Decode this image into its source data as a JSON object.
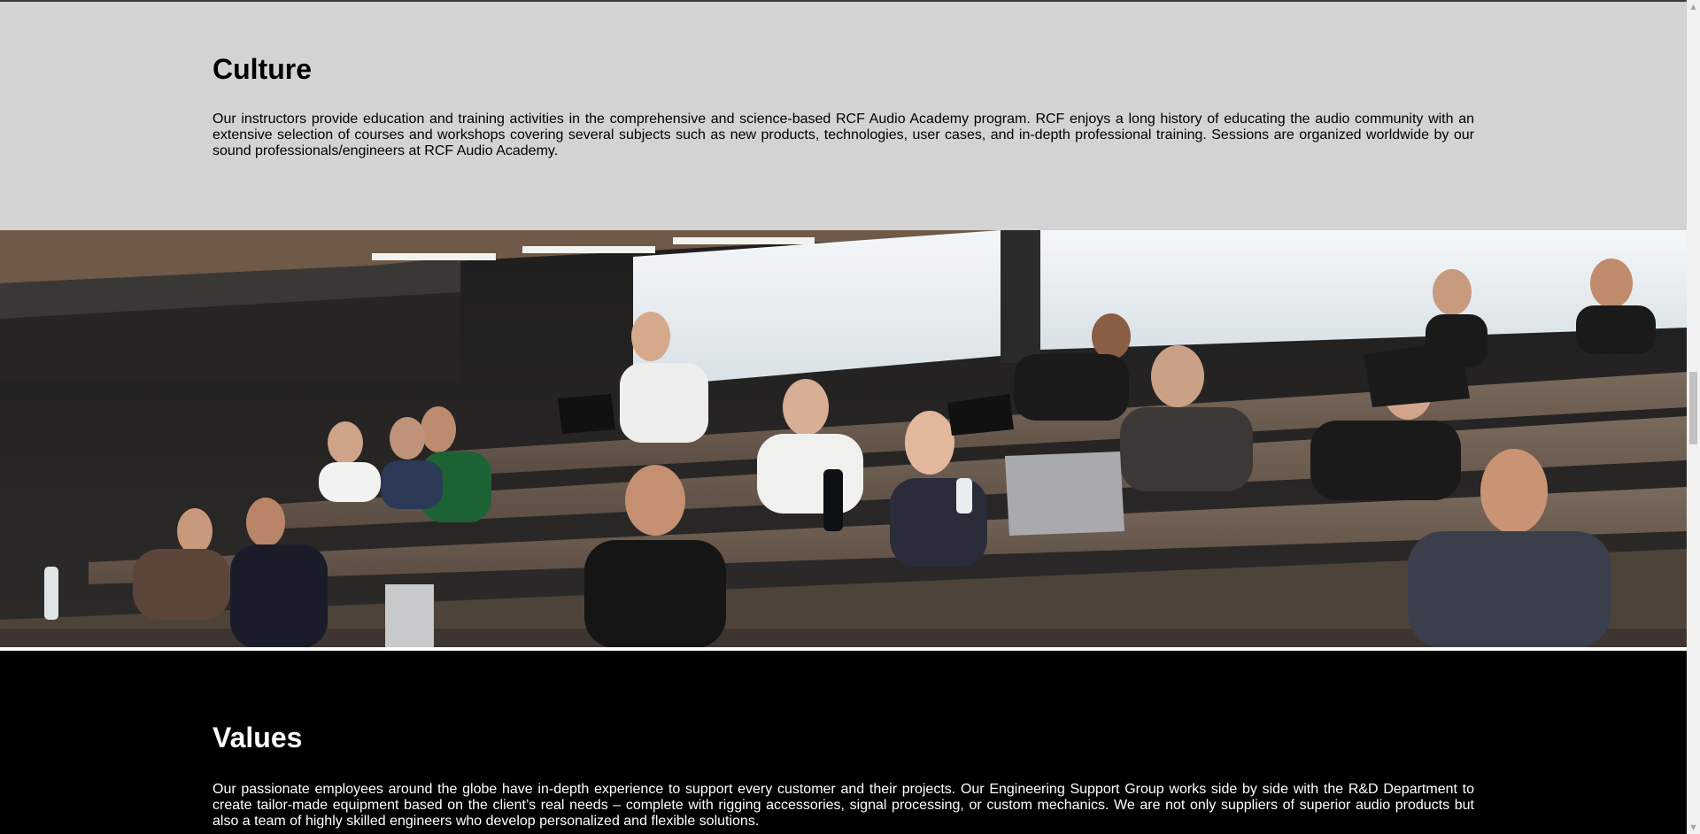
{
  "culture": {
    "title": "Culture",
    "text": "Our instructors provide education and training activities in the comprehensive and science-based RCF Audio Academy program. RCF enjoys a long history of educating the audio community with an extensive selection of courses and workshops covering several subjects such as new products, technologies, user cases, and in-depth professional training. Sessions are organized worldwide by our sound professionals/engineers at RCF Audio Academy.",
    "background": "#d3d3d3"
  },
  "photo": {
    "icon": "classroom-photo"
  },
  "values": {
    "title": "Values",
    "text": "Our passionate employees around the globe have in-depth experience to support every customer and their projects. Our Engineering Support Group works side by side with the R&D Department to create tailor-made equipment based on the client’s real needs – complete with rigging accessories, signal processing, or custom mechanics. We are not only suppliers of superior audio products but also a team of highly skilled engineers who develop personalized and flexible solutions.",
    "background": "#000000"
  },
  "scrollbar": {
    "up_icon": "▲",
    "down_icon": "▼"
  }
}
